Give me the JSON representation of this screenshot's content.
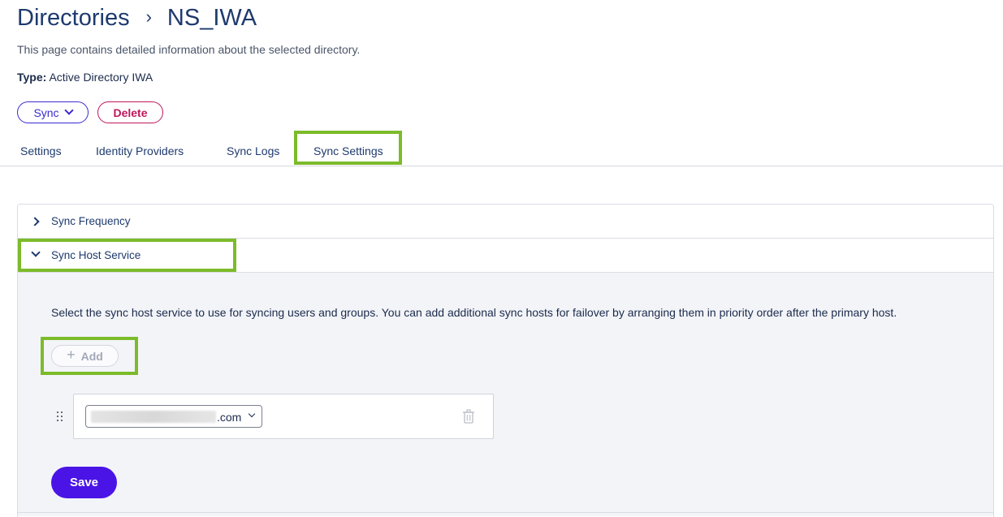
{
  "breadcrumb": {
    "parent": "Directories",
    "separator": "›",
    "current": "NS_IWA"
  },
  "page": {
    "description": "This page contains detailed information about the selected directory.",
    "type_label": "Type:",
    "type_value": "Active Directory IWA"
  },
  "actions": {
    "sync_label": "Sync",
    "delete_label": "Delete"
  },
  "tabs": [
    {
      "label": "Settings"
    },
    {
      "label": "Identity Providers"
    },
    {
      "label": "Sync Logs"
    },
    {
      "label": "Sync Settings",
      "active": true
    }
  ],
  "accordion": {
    "sync_frequency": {
      "label": "Sync Frequency",
      "expanded": false
    },
    "sync_host_service": {
      "label": "Sync Host Service",
      "expanded": true,
      "description": "Select the sync host service to use for syncing users and groups. You can add additional sync hosts for failover by arranging them in priority order after the primary host.",
      "add_label": "Add",
      "add_disabled": true,
      "hosts": [
        {
          "suffix": ".com",
          "redacted": true
        }
      ],
      "save_label": "Save"
    }
  },
  "colors": {
    "highlight": "#7cbb2a",
    "primary": "#4a14e6",
    "sync_border": "#3a2bd1",
    "delete": "#c0175d",
    "link": "#1e3a6e"
  },
  "icons": [
    "chevron-right-icon",
    "chevron-down-icon",
    "plus-icon",
    "drag-handle-icon",
    "trash-icon"
  ]
}
